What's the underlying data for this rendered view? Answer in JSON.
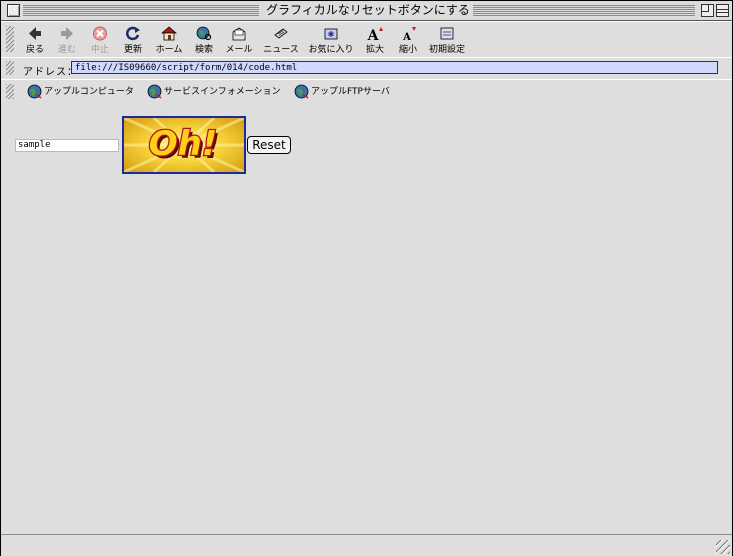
{
  "window": {
    "title": "グラフィカルなリセットボタンにする"
  },
  "toolbar": {
    "buttons": [
      {
        "label": "戻る",
        "icon": "back-arrow-icon",
        "enabled": true
      },
      {
        "label": "進む",
        "icon": "forward-arrow-icon",
        "enabled": false
      },
      {
        "label": "中止",
        "icon": "stop-icon",
        "enabled": false
      },
      {
        "label": "更新",
        "icon": "refresh-icon",
        "enabled": true
      },
      {
        "label": "ホーム",
        "icon": "home-icon",
        "enabled": true
      },
      {
        "label": "検索",
        "icon": "search-globe-icon",
        "enabled": true
      },
      {
        "label": "メール",
        "icon": "mail-icon",
        "enabled": true
      },
      {
        "label": "ニュース",
        "icon": "news-icon",
        "enabled": true
      },
      {
        "label": "お気に入り",
        "icon": "favorites-icon",
        "enabled": true
      },
      {
        "label": "拡大",
        "icon": "text-larger-icon",
        "enabled": true
      },
      {
        "label": "縮小",
        "icon": "text-smaller-icon",
        "enabled": true
      },
      {
        "label": "初期設定",
        "icon": "preferences-icon",
        "enabled": true
      }
    ]
  },
  "address": {
    "label": "アドレス：",
    "value": "file:///IS09660/script/form/014/code.html"
  },
  "favorites": [
    {
      "label": "アップルコンピュータ",
      "icon": "globe-icon"
    },
    {
      "label": "サービスインフォメーション",
      "icon": "globe-icon"
    },
    {
      "label": "アップルFTPサーバ",
      "icon": "globe-icon"
    }
  ],
  "form": {
    "text_value": "sample",
    "image_button_text": "Oh!",
    "reset_label": "Reset"
  },
  "colors": {
    "address_bg": "#cfd8ff",
    "image_border": "#1b2aa0",
    "oh_fill": "#ffd21a",
    "oh_outline": "#b5121b"
  }
}
